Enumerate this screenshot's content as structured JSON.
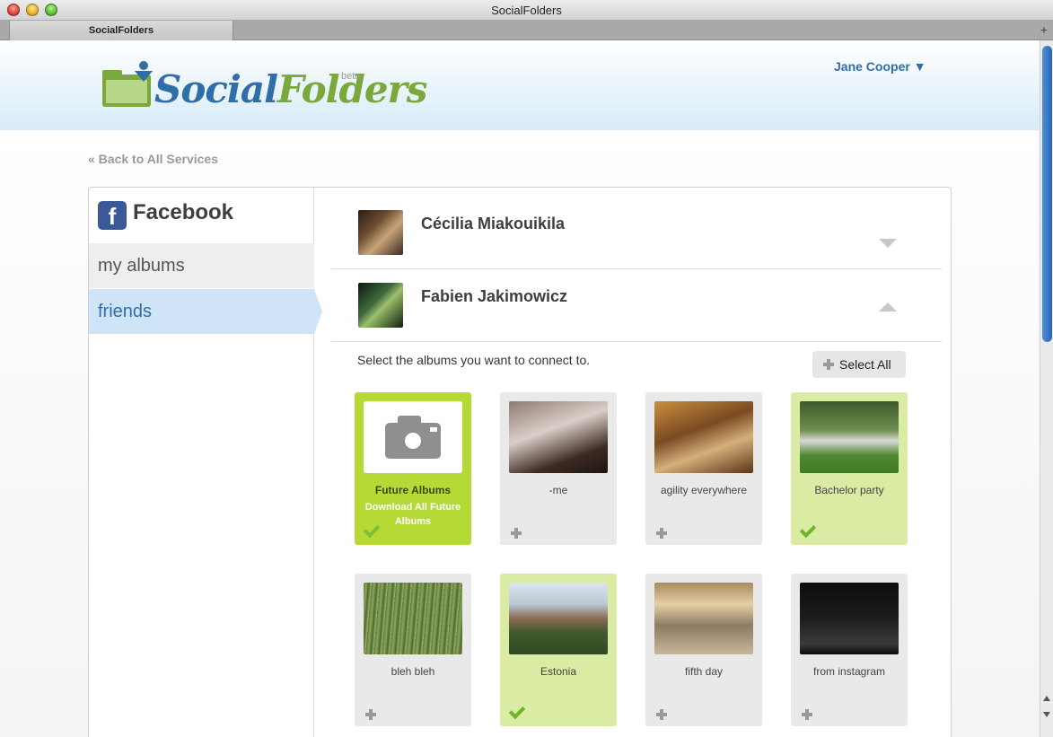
{
  "window": {
    "title": "SocialFolders"
  },
  "tabs": [
    {
      "label": "SocialFolders"
    }
  ],
  "header": {
    "logo_text_primary": "Social",
    "logo_text_secondary": "Folders",
    "logo_badge": "beta",
    "user_name": "Jane Cooper ▼"
  },
  "nav": {
    "back_link": "« Back to All Services"
  },
  "sidebar": {
    "service": "Facebook",
    "items": [
      {
        "label": "my albums",
        "active": false
      },
      {
        "label": "friends",
        "active": true
      }
    ]
  },
  "friends": [
    {
      "name": "Cécilia Miakouikila",
      "expanded": false
    },
    {
      "name": "Fabien Jakimowicz",
      "expanded": true
    }
  ],
  "albums_section": {
    "hint": "Select the albums you want to connect to.",
    "select_all": "Select All"
  },
  "albums": [
    {
      "name": "Future Albums",
      "sub": "Download All Future Albums",
      "checked": true,
      "type": "future"
    },
    {
      "name": "-me",
      "checked": false
    },
    {
      "name": "agility everywhere",
      "checked": false
    },
    {
      "name": "Bachelor party",
      "checked": true
    },
    {
      "name": "bleh bleh",
      "checked": false
    },
    {
      "name": "Estonia",
      "checked": true
    },
    {
      "name": "fifth day",
      "checked": false
    },
    {
      "name": "from instagram",
      "checked": false
    }
  ],
  "colors": {
    "accent_blue": "#2f6ea8",
    "future_green": "#b5d935",
    "checked_green": "#daeba3",
    "facebook_blue": "#3b5998"
  }
}
